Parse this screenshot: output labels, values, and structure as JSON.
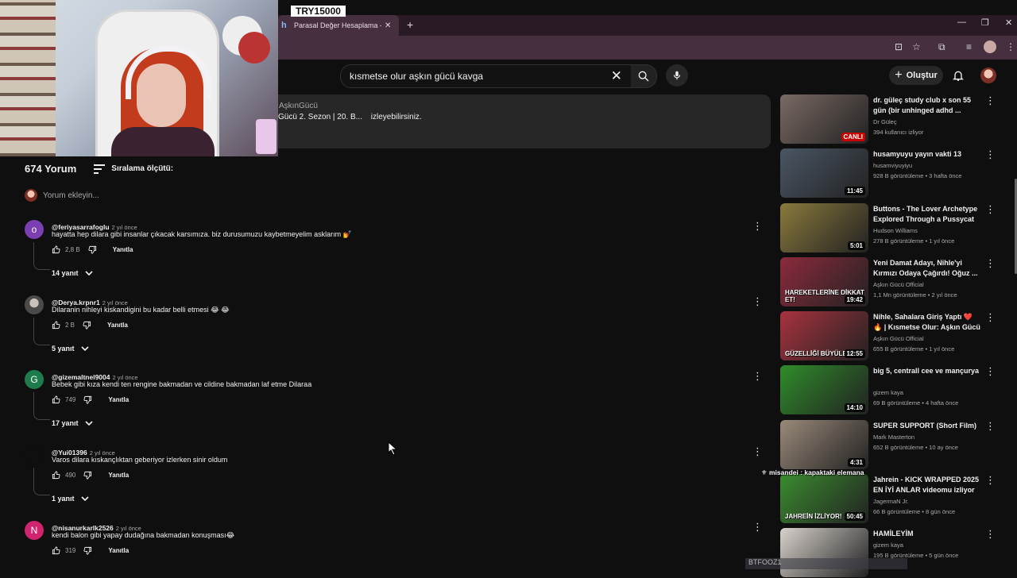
{
  "overlay": {
    "donation": "TRY15000",
    "chat_line": "misandei : kapaktaki elemana",
    "watermark": "BTFOOZ1"
  },
  "browser": {
    "tab_title": "Parasal Değer Hesaplama - HEI",
    "tab_favicon": "h"
  },
  "header": {
    "search_query": "kısmetse olur aşkın gücü kavga",
    "create_label": "Oluştur"
  },
  "description": {
    "channel": "AşkınGücü",
    "line_a": "Gücü 2. Sezon | 20. B...",
    "line_b": "izleyebilirsiniz."
  },
  "comments_header": {
    "count": "674 Yorum",
    "sort_label": "Sıralama ölçütü:",
    "add_placeholder": "Yorum ekleyin..."
  },
  "reply_label": "Yanıtla",
  "comments": [
    {
      "author": "@feriyasarrafoglu",
      "date": "2 yıl önce",
      "text": "hayatta hep dilara gibi insanlar çıkacak karsımıza. biz durusumuzu kaybetmeyelim asklarım 💅",
      "likes": "2,8 B",
      "replies": "14 yanıt",
      "avatar_letter": "o",
      "avatar_color": "#7b3fb2"
    },
    {
      "author": "@Derya.krpnr1",
      "date": "2 yıl önce",
      "text": "Dilaranin nihleyi kiskandigini bu kadar belli etmesi 😂 😂",
      "likes": "2 B",
      "replies": "5 yanıt",
      "avatar_letter": "",
      "avatar_color": "#5a5a5a"
    },
    {
      "author": "@gizemaltnel9004",
      "date": "2 yıl önce",
      "text": "Bebek gibi kıza kendi ten rengine bakmadan ve cildine bakmadan laf etme Dilaraa",
      "likes": "749",
      "replies": "17 yanıt",
      "avatar_letter": "G",
      "avatar_color": "#1e7c4c"
    },
    {
      "author": "@Yui01396",
      "date": "2 yıl önce",
      "text": "Varos dilara kıskançlıktan geberiyor izlerken sinir oldum",
      "likes": "490",
      "replies": "1 yanıt",
      "avatar_letter": "",
      "avatar_color": "#0f0f0f"
    },
    {
      "author": "@nisanurkarlk2526",
      "date": "2 yıl önce",
      "text": "kendi balon gibi yapay dudağına bakmadan konuşması😂",
      "likes": "319",
      "replies": "",
      "avatar_letter": "N",
      "avatar_color": "#d0246e"
    }
  ],
  "recommendations": [
    {
      "title": "dr. güleç study club x son 55 gün (bir unhinged adhd ...",
      "channel": "Dr Güleç",
      "stats": "394 kullanıcı izliyor",
      "badge": "CANLI",
      "caption": "",
      "thumb_color": "#7a6a64"
    },
    {
      "title": "husamyuyu yayın vakti 13",
      "channel": "husamviyuyiyu",
      "stats": "928 B görüntüleme • 3 hafta önce",
      "badge": "11:45",
      "caption": "",
      "thumb_color": "#4a5664"
    },
    {
      "title": "Buttons - The Lover Archetype Explored Through a Pussycat ...",
      "channel": "Hudson Williams",
      "stats": "278 B görüntüleme • 1 yıl önce",
      "badge": "5:01",
      "caption": "",
      "thumb_color": "#8a7a3c"
    },
    {
      "title": "Yeni Damat Adayı, Nihle'yi Kırmızı Odaya Çağırdı! Oğuz ...",
      "channel": "Aşkın Gücü Official",
      "stats": "1,1 Mn görüntüleme • 2 yıl önce",
      "badge": "19:42",
      "caption": "HAREKETLERİNE DİKKAT ET!",
      "thumb_color": "#8c2a3c"
    },
    {
      "title": "Nihle, Sahalara Giriş Yaptı ❤️🔥 | Kısmetse Olur: Aşkın Gücü",
      "channel": "Aşkın Gücü Official",
      "stats": "655 B görüntüleme • 1 yıl önce",
      "badge": "12:55",
      "caption": "GÜZELLİĞİ BÜYÜLEDİ!",
      "thumb_color": "#a8323e"
    },
    {
      "title": "big 5, centrall cee ve mançurya",
      "channel": "gizem kaya",
      "stats": "69 B görüntüleme • 4 hafta önce",
      "badge": "14:10",
      "caption": "",
      "thumb_color": "#2f8c2a"
    },
    {
      "title": "SUPER SUPPORT (Short Film)",
      "channel": "Mark Masterton",
      "stats": "652 B görüntüleme • 10 ay önce",
      "badge": "4:31",
      "caption": "",
      "thumb_color": "#9a8a7a"
    },
    {
      "title": "Jahrein - KICK WRAPPED 2025 EN İYİ ANLAR videomu izliyor",
      "channel": "JagermaN Jr.",
      "stats": "66 B görüntüleme • 8 gün önce",
      "badge": "50:45",
      "caption": "JAHREİN İZLİYOR!",
      "thumb_color": "#3a8c2f"
    },
    {
      "title": "HAMİLEYİM",
      "channel": "gizem kaya",
      "stats": "195 B görüntüleme • 5 gün önce",
      "badge": "",
      "caption": "",
      "thumb_color": "#d8d2cc"
    }
  ],
  "colors": {
    "background": "#0f0f0f",
    "chip": "#272727",
    "live": "#cc0000",
    "tab_bar": "#2a1a26",
    "address_bar": "#46303f"
  }
}
